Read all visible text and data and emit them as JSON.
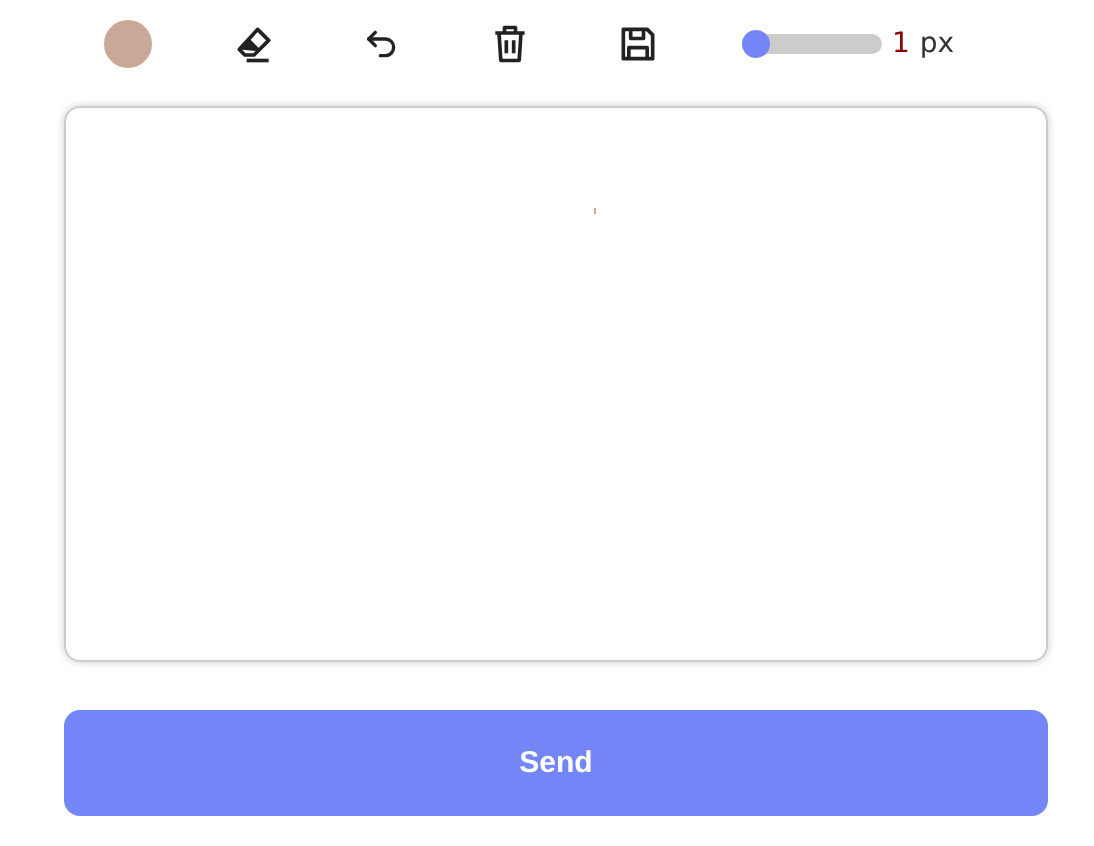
{
  "toolbar": {
    "swatch": {
      "color": "#c9a898"
    },
    "size_slider": {
      "level": 0.0
    },
    "size_value": "1",
    "size_unit": "px"
  },
  "send_button": {
    "label": "Send"
  }
}
